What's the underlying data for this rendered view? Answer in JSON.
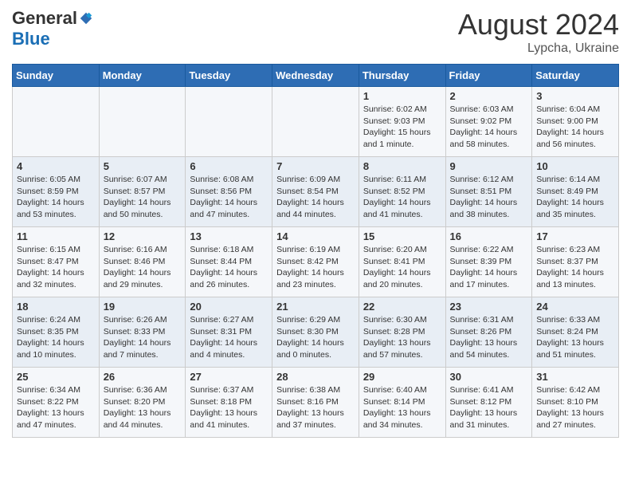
{
  "logo": {
    "general": "General",
    "blue": "Blue"
  },
  "title": {
    "month": "August 2024",
    "location": "Lypcha, Ukraine"
  },
  "weekdays": [
    "Sunday",
    "Monday",
    "Tuesday",
    "Wednesday",
    "Thursday",
    "Friday",
    "Saturday"
  ],
  "weeks": [
    [
      {
        "day": "",
        "info": ""
      },
      {
        "day": "",
        "info": ""
      },
      {
        "day": "",
        "info": ""
      },
      {
        "day": "",
        "info": ""
      },
      {
        "day": "1",
        "info": "Sunrise: 6:02 AM\nSunset: 9:03 PM\nDaylight: 15 hours\nand 1 minute."
      },
      {
        "day": "2",
        "info": "Sunrise: 6:03 AM\nSunset: 9:02 PM\nDaylight: 14 hours\nand 58 minutes."
      },
      {
        "day": "3",
        "info": "Sunrise: 6:04 AM\nSunset: 9:00 PM\nDaylight: 14 hours\nand 56 minutes."
      }
    ],
    [
      {
        "day": "4",
        "info": "Sunrise: 6:05 AM\nSunset: 8:59 PM\nDaylight: 14 hours\nand 53 minutes."
      },
      {
        "day": "5",
        "info": "Sunrise: 6:07 AM\nSunset: 8:57 PM\nDaylight: 14 hours\nand 50 minutes."
      },
      {
        "day": "6",
        "info": "Sunrise: 6:08 AM\nSunset: 8:56 PM\nDaylight: 14 hours\nand 47 minutes."
      },
      {
        "day": "7",
        "info": "Sunrise: 6:09 AM\nSunset: 8:54 PM\nDaylight: 14 hours\nand 44 minutes."
      },
      {
        "day": "8",
        "info": "Sunrise: 6:11 AM\nSunset: 8:52 PM\nDaylight: 14 hours\nand 41 minutes."
      },
      {
        "day": "9",
        "info": "Sunrise: 6:12 AM\nSunset: 8:51 PM\nDaylight: 14 hours\nand 38 minutes."
      },
      {
        "day": "10",
        "info": "Sunrise: 6:14 AM\nSunset: 8:49 PM\nDaylight: 14 hours\nand 35 minutes."
      }
    ],
    [
      {
        "day": "11",
        "info": "Sunrise: 6:15 AM\nSunset: 8:47 PM\nDaylight: 14 hours\nand 32 minutes."
      },
      {
        "day": "12",
        "info": "Sunrise: 6:16 AM\nSunset: 8:46 PM\nDaylight: 14 hours\nand 29 minutes."
      },
      {
        "day": "13",
        "info": "Sunrise: 6:18 AM\nSunset: 8:44 PM\nDaylight: 14 hours\nand 26 minutes."
      },
      {
        "day": "14",
        "info": "Sunrise: 6:19 AM\nSunset: 8:42 PM\nDaylight: 14 hours\nand 23 minutes."
      },
      {
        "day": "15",
        "info": "Sunrise: 6:20 AM\nSunset: 8:41 PM\nDaylight: 14 hours\nand 20 minutes."
      },
      {
        "day": "16",
        "info": "Sunrise: 6:22 AM\nSunset: 8:39 PM\nDaylight: 14 hours\nand 17 minutes."
      },
      {
        "day": "17",
        "info": "Sunrise: 6:23 AM\nSunset: 8:37 PM\nDaylight: 14 hours\nand 13 minutes."
      }
    ],
    [
      {
        "day": "18",
        "info": "Sunrise: 6:24 AM\nSunset: 8:35 PM\nDaylight: 14 hours\nand 10 minutes."
      },
      {
        "day": "19",
        "info": "Sunrise: 6:26 AM\nSunset: 8:33 PM\nDaylight: 14 hours\nand 7 minutes."
      },
      {
        "day": "20",
        "info": "Sunrise: 6:27 AM\nSunset: 8:31 PM\nDaylight: 14 hours\nand 4 minutes."
      },
      {
        "day": "21",
        "info": "Sunrise: 6:29 AM\nSunset: 8:30 PM\nDaylight: 14 hours\nand 0 minutes."
      },
      {
        "day": "22",
        "info": "Sunrise: 6:30 AM\nSunset: 8:28 PM\nDaylight: 13 hours\nand 57 minutes."
      },
      {
        "day": "23",
        "info": "Sunrise: 6:31 AM\nSunset: 8:26 PM\nDaylight: 13 hours\nand 54 minutes."
      },
      {
        "day": "24",
        "info": "Sunrise: 6:33 AM\nSunset: 8:24 PM\nDaylight: 13 hours\nand 51 minutes."
      }
    ],
    [
      {
        "day": "25",
        "info": "Sunrise: 6:34 AM\nSunset: 8:22 PM\nDaylight: 13 hours\nand 47 minutes."
      },
      {
        "day": "26",
        "info": "Sunrise: 6:36 AM\nSunset: 8:20 PM\nDaylight: 13 hours\nand 44 minutes."
      },
      {
        "day": "27",
        "info": "Sunrise: 6:37 AM\nSunset: 8:18 PM\nDaylight: 13 hours\nand 41 minutes."
      },
      {
        "day": "28",
        "info": "Sunrise: 6:38 AM\nSunset: 8:16 PM\nDaylight: 13 hours\nand 37 minutes."
      },
      {
        "day": "29",
        "info": "Sunrise: 6:40 AM\nSunset: 8:14 PM\nDaylight: 13 hours\nand 34 minutes."
      },
      {
        "day": "30",
        "info": "Sunrise: 6:41 AM\nSunset: 8:12 PM\nDaylight: 13 hours\nand 31 minutes."
      },
      {
        "day": "31",
        "info": "Sunrise: 6:42 AM\nSunset: 8:10 PM\nDaylight: 13 hours\nand 27 minutes."
      }
    ]
  ]
}
